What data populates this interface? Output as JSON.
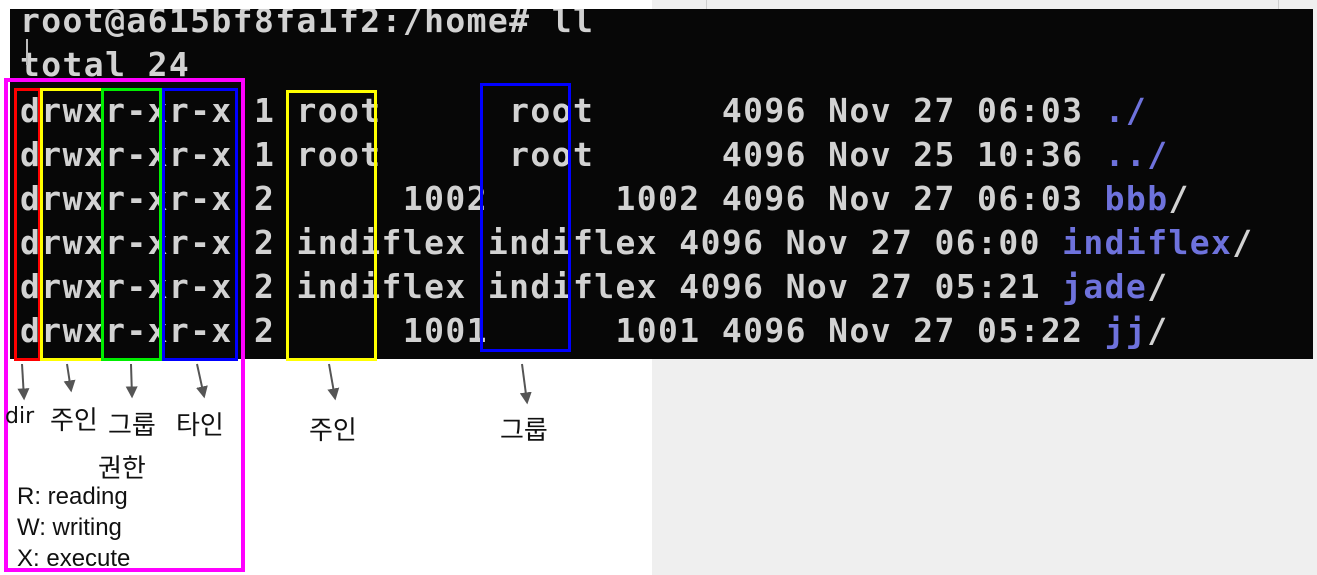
{
  "terminal": {
    "prompt": "root@a615bf8fa1f2:/home# ll",
    "total": "total 24",
    "rows": [
      {
        "prefix": "drwxr-xr-x 1 root      root      4096 Nov 27 06:03 ",
        "name": "./"
      },
      {
        "prefix": "drwxr-xr-x 1 root      root      4096 Nov 25 10:36 ",
        "name": "../"
      },
      {
        "prefix": "drwxr-xr-x 2      1002      1002 4096 Nov 27 06:03 ",
        "name": "bbb",
        "suffix": "/"
      },
      {
        "prefix": "drwxr-xr-x 2 indiflex indiflex 4096 Nov 27 06:00 ",
        "name": "indiflex",
        "suffix": "/"
      },
      {
        "prefix": "drwxr-xr-x 2 indiflex indiflex 4096 Nov 27 05:21 ",
        "name": "jade",
        "suffix": "/"
      },
      {
        "prefix": "drwxr-xr-x 2      1001      1001 4096 Nov 27 05:22 ",
        "name": "jj",
        "suffix": "/"
      }
    ]
  },
  "annotations": {
    "dir": "dir",
    "owner_perm": "주인",
    "group_perm": "그룹",
    "other_perm": "타인",
    "owner": "주인",
    "group": "그룹",
    "permission_title": "권한",
    "legend": [
      "R: reading",
      "W: writing",
      "X: execute"
    ]
  },
  "colors": {
    "terminal_bg": "#070707",
    "terminal_text": "#d2d2d2",
    "directory": "#6e72dc",
    "dir_box": "#ff0000",
    "owner_box": "#ffff00",
    "group_box": "#00ee00",
    "other_box": "#0000ff",
    "permission_box": "#ff00ff"
  }
}
